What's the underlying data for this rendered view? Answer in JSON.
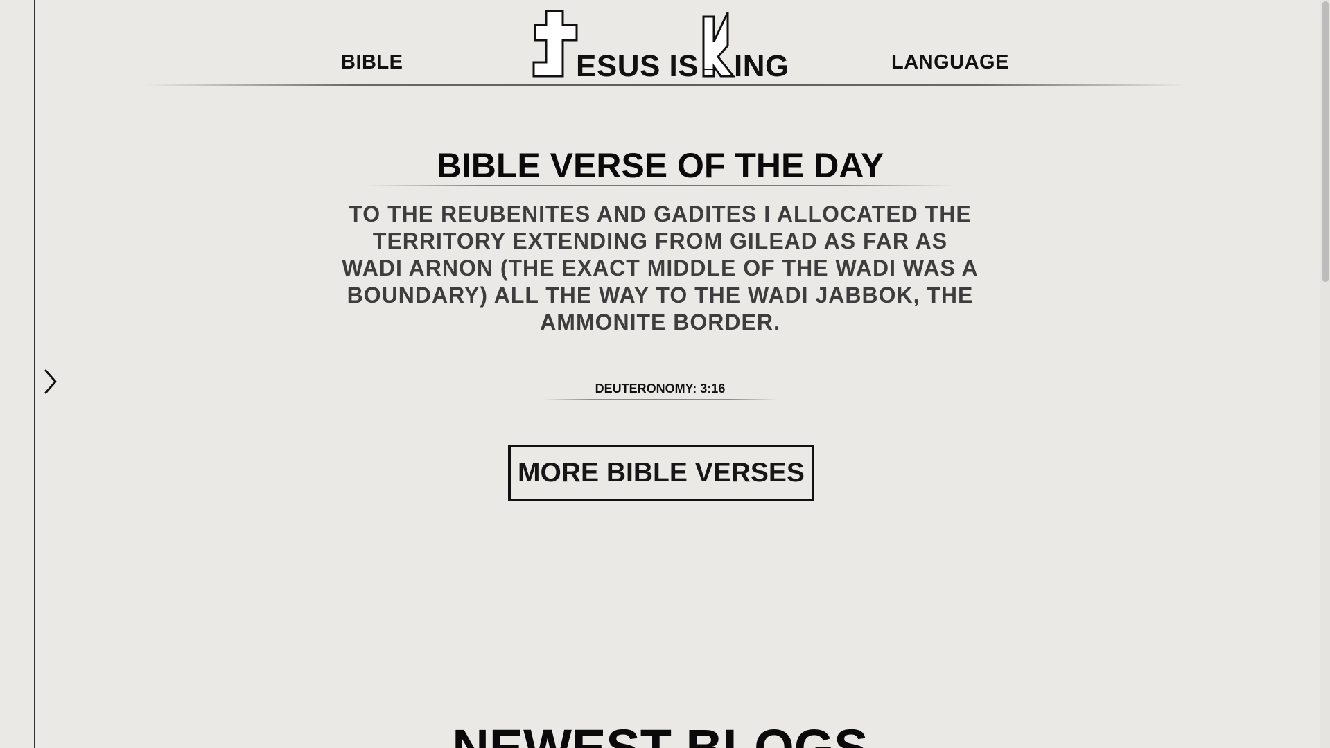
{
  "header": {
    "nav_left": "BIBLE",
    "nav_right": "LANGUAGE",
    "logo": {
      "letter_j": "J",
      "part_1": "ESUS IS",
      "letter_k": "K",
      "part_2": "ING"
    }
  },
  "verse_of_day": {
    "heading": "BIBLE VERSE OF THE DAY",
    "text": "TO THE REUBENITES AND GADITES I ALLOCATED THE TERRITORY EXTENDING FROM GILEAD AS FAR AS WADI ARNON (THE EXACT MIDDLE OF THE WADI WAS A BOUNDARY) ALL THE WAY TO THE WADI JABBOK, THE AMMONITE BORDER.",
    "reference": "DEUTERONOMY: 3:16",
    "button_label": "MORE BIBLE VERSES"
  },
  "blogs": {
    "heading": "NEWEST BLOGS"
  },
  "icons": {
    "sidebar_toggle": "chevron-right-icon",
    "logo_cross": "cross-icon"
  },
  "colors": {
    "background": "#ebe9e5",
    "text": "#111111",
    "verse_text": "#3d3d3d"
  }
}
